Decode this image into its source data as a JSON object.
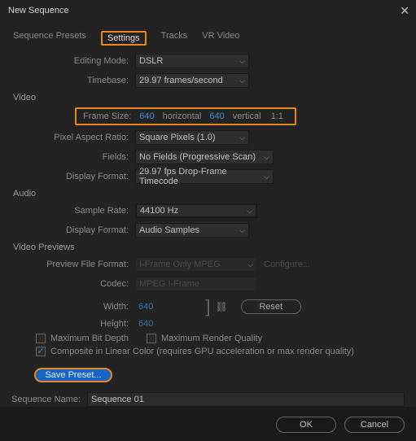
{
  "title": "New Sequence",
  "tabs": {
    "presets": "Sequence Presets",
    "settings": "Settings",
    "tracks": "Tracks",
    "vrvideo": "VR Video"
  },
  "labels": {
    "editing_mode": "Editing Mode:",
    "timebase": "Timebase:",
    "frame_size": "Frame Size:",
    "horizontal": "horizontal",
    "vertical": "vertical",
    "pixel_aspect": "Pixel Aspect Ratio:",
    "fields": "Fields:",
    "vdisplay": "Display Format:",
    "sample_rate": "Sample Rate:",
    "adisplay": "Display Format:",
    "preview_format": "Preview File Format:",
    "codec": "Codec:",
    "width": "Width:",
    "height": "Height:",
    "max_bit": "Maximum Bit Depth",
    "max_render": "Maximum Render Quality",
    "composite": "Composite in Linear Color (requires GPU acceleration or max render quality)",
    "sequence_name": "Sequence Name:"
  },
  "sections": {
    "video": "Video",
    "audio": "Audio",
    "previews": "Video Previews"
  },
  "values": {
    "editing_mode": "DSLR",
    "timebase": "29.97 frames/second",
    "frame_w": "640",
    "frame_h": "640",
    "ratio": "1:1",
    "pixel_aspect": "Square Pixels (1.0)",
    "fields": "No Fields (Progressive Scan)",
    "vdisplay": "29.97 fps Drop-Frame Timecode",
    "sample_rate": "44100 Hz",
    "adisplay": "Audio Samples",
    "preview_format": "I-Frame Only MPEG",
    "configure": "Configure...",
    "codec": "MPEG I-Frame",
    "width": "640",
    "height": "640",
    "reset": "Reset",
    "save_preset": "Save Preset...",
    "sequence_name": "Sequence 01",
    "ok": "OK",
    "cancel": "Cancel"
  }
}
